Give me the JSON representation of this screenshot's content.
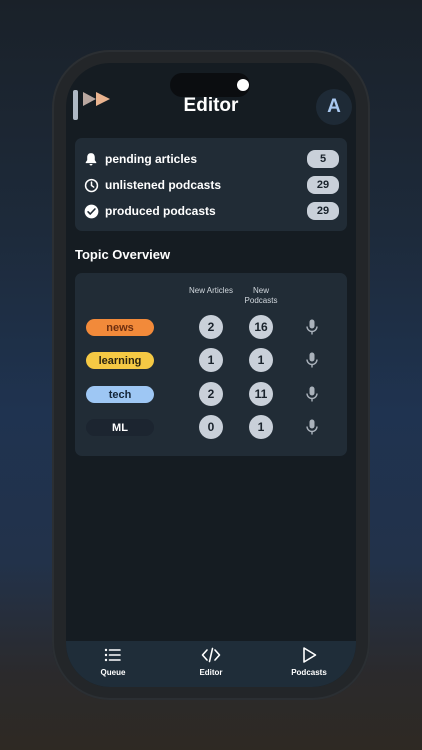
{
  "header": {
    "title": "Editor",
    "avatar_letter": "A"
  },
  "stats": [
    {
      "icon": "bell-icon",
      "label": "pending articles",
      "count": "5"
    },
    {
      "icon": "clock-icon",
      "label": "unlistened podcasts",
      "count": "29"
    },
    {
      "icon": "check-circle-icon",
      "label": "produced podcasts",
      "count": "29"
    }
  ],
  "topic_overview": {
    "title": "Topic Overview",
    "col_articles": "New Articles",
    "col_podcasts_1": "New",
    "col_podcasts_2": "Podcasts",
    "rows": [
      {
        "name": "news",
        "articles": "2",
        "podcasts": "16",
        "tag_bg": "#f28a3a",
        "tag_fg": "#6e2f10"
      },
      {
        "name": "learning",
        "articles": "1",
        "podcasts": "1",
        "tag_bg": "#f5c944",
        "tag_fg": "#2a2310"
      },
      {
        "name": "tech",
        "articles": "2",
        "podcasts": "11",
        "tag_bg": "#9ec7f4",
        "tag_fg": "#14263a"
      },
      {
        "name": "ML",
        "articles": "0",
        "podcasts": "1",
        "tag_bg": "#1c2530",
        "tag_fg": "#ffffff"
      }
    ]
  },
  "tabs": [
    {
      "icon": "list-icon",
      "label": "Queue"
    },
    {
      "icon": "code-icon",
      "label": "Editor"
    },
    {
      "icon": "play-icon",
      "label": "Podcasts"
    }
  ],
  "colors": {
    "accent_logo_bar": "#aeb8c4",
    "accent_logo_play": "#e9b38f"
  }
}
